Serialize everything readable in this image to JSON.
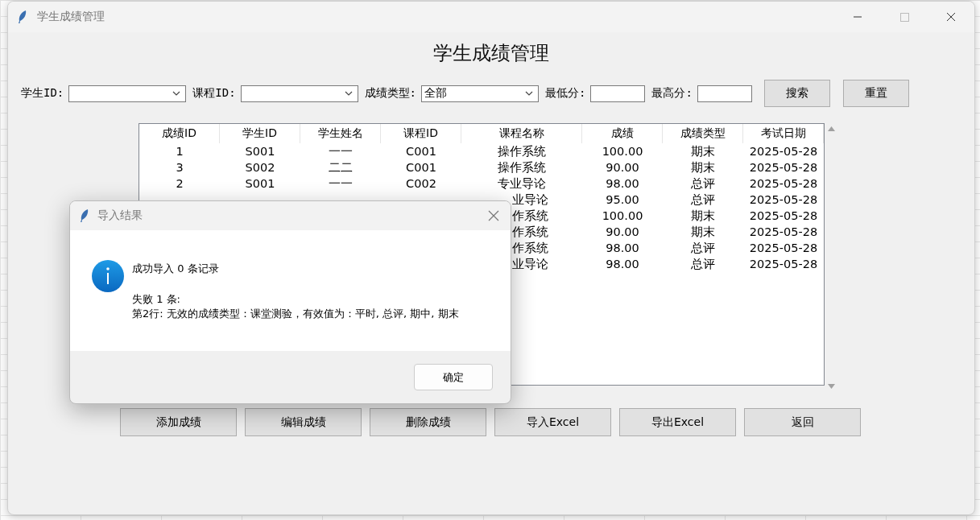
{
  "window": {
    "title": "学生成绩管理"
  },
  "heading": "学生成绩管理",
  "filters": [
    {
      "kind": "combo",
      "label": "学生ID:"
    },
    {
      "kind": "combo",
      "label": "课程ID:"
    },
    {
      "kind": "combo",
      "label": "成绩类型:",
      "value": "全部"
    },
    {
      "kind": "entry",
      "label": "最低分:"
    },
    {
      "kind": "entry",
      "label": "最高分:"
    }
  ],
  "filter_buttons": [
    "搜索",
    "重置"
  ],
  "table": {
    "columns": [
      "成绩ID",
      "学生ID",
      "学生姓名",
      "课程ID",
      "课程名称",
      "成绩",
      "成绩类型",
      "考试日期"
    ],
    "rows": [
      {
        "cells": [
          "1",
          "S001",
          "一一",
          "C001",
          "操作系统",
          "100.00",
          "期末",
          "2025-05-28"
        ]
      },
      {
        "cells": [
          "3",
          "S002",
          "二二",
          "C001",
          "操作系统",
          "90.00",
          "期末",
          "2025-05-28"
        ]
      },
      {
        "cells": [
          "2",
          "S001",
          "一一",
          "C002",
          "专业导论",
          "98.00",
          "总评",
          "2025-05-28"
        ]
      },
      {
        "cells": [
          null,
          null,
          null,
          null,
          "业导论",
          "95.00",
          "总评",
          "2025-05-28"
        ]
      },
      {
        "cells": [
          null,
          null,
          null,
          null,
          "作系统",
          "100.00",
          "期末",
          "2025-05-28"
        ]
      },
      {
        "cells": [
          null,
          null,
          null,
          null,
          "作系统",
          "90.00",
          "期末",
          "2025-05-28"
        ]
      },
      {
        "cells": [
          null,
          null,
          null,
          null,
          "作系统",
          "98.00",
          "总评",
          "2025-05-28"
        ]
      },
      {
        "cells": [
          null,
          null,
          null,
          null,
          "业导论",
          "98.00",
          "总评",
          "2025-05-28"
        ]
      }
    ]
  },
  "actions": [
    "添加成绩",
    "编辑成绩",
    "删除成绩",
    "导入Excel",
    "导出Excel",
    "返回"
  ],
  "dialog": {
    "title": "导入结果",
    "message": "成功导入 0 条记录",
    "detail_lines": [
      "失败 1 条:",
      "第2行: 无效的成绩类型：课堂测验，有效值为：平时, 总评, 期中, 期末"
    ],
    "button": "确定"
  }
}
